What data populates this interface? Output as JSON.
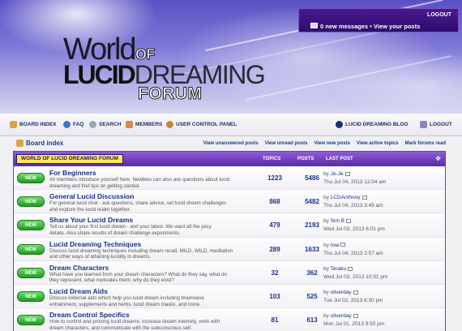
{
  "header": {
    "logo": {
      "line1": "World",
      "line1b": "OF",
      "line2a": "LUCID",
      "line2b": "DREAMING",
      "line3": "FORUM"
    },
    "userbox": {
      "logout": "LOGOUT",
      "messages": "0 new messages • View your posts"
    }
  },
  "nav": {
    "board_index": "BOARD INDEX",
    "faq": "FAQ",
    "search": "SEARCH",
    "members": "MEMBERS",
    "ucp": "USER CONTROL PANEL",
    "blog": "LUCID DREAMING BLOG",
    "logout": "LOGOUT"
  },
  "crumbs": {
    "board_index": "Board index"
  },
  "quick_links": [
    "View unanswered posts",
    "View unread posts",
    "View new posts",
    "View active topics",
    "Mark forums read"
  ],
  "category": {
    "title": "WORLD OF LUCID DREAMING FORUM",
    "col_topics": "TOPICS",
    "col_posts": "POSTS",
    "col_last": "LAST POST"
  },
  "forums": [
    {
      "badge": "NEW",
      "title": "For Beginners",
      "desc1": "All members introduce yourself here. Newbies can also ask questions about lucid",
      "desc2": "dreaming and find tips on getting started.",
      "topics": "1223",
      "posts": "5486",
      "by": "by ",
      "author": "Je-Je",
      "date": "Thu Jul 04, 2013 12:04 am"
    },
    {
      "badge": "NEW",
      "title": "General Lucid Discussion",
      "desc1": "For general lucid chat - ask questions, share advice, set lucid dream challenges",
      "desc2": "and explore the lucid realm together.",
      "topics": "868",
      "posts": "5482",
      "by": "by ",
      "author": "LCDAnthony",
      "date": "Thu Jul 04, 2013 3:45 am"
    },
    {
      "badge": "NEW",
      "title": "Share Your Lucid Dreams",
      "desc1": "Tell us about your first lucid dream - and your latest. We want all the juicy",
      "desc2": "details. Also share results of dream challenge experiments.",
      "topics": "479",
      "posts": "2193",
      "by": "by ",
      "author": "Sim B",
      "date": "Wed Jul 03, 2013 6:01 pm"
    },
    {
      "badge": "NEW",
      "title": "Lucid Dreaming Techniques",
      "desc1": "Discuss lucid dreaming techniques including dream recall, MILD, WILD, meditation",
      "desc2": "and other ways of attaining lucidity in dreams.",
      "topics": "289",
      "posts": "1633",
      "by": "by ",
      "author": "mia",
      "date": "Thu Jul 04, 2013 2:57 am"
    },
    {
      "badge": "NEW",
      "title": "Dream Characters",
      "desc1": "What have you learned from your dream characters? What do they say, what do",
      "desc2": "they represent, what motivates them, why do they exist?",
      "topics": "32",
      "posts": "362",
      "by": "by ",
      "author": "Teraku",
      "date": "Wed Jul 03, 2013 10:31 pm"
    },
    {
      "badge": "NEW",
      "title": "Lucid Dream Aids",
      "desc1": "Discuss external aids which help you lucid dream including brainwave",
      "desc2": "entrainment, supplements and herbs, lucid dream masks, and more.",
      "topics": "103",
      "posts": "525",
      "by": "by ",
      "author": "oliverday",
      "date": "Tue Jul 02, 2013 6:30 pm"
    },
    {
      "badge": "NEW",
      "title": "Dream Control Specifics",
      "desc1": "How to control and prolong lucid dreams, increase dream intensity, work with",
      "desc2": "dream characters, and communicate with the subconscious self.",
      "topics": "81",
      "posts": "613",
      "by": "by ",
      "author": "oliverday",
      "date": "Mon Jul 01, 2013 9:50 pm"
    }
  ]
}
